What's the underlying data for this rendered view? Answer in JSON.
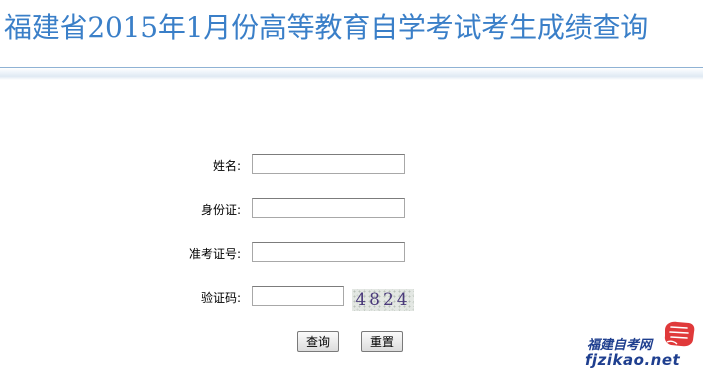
{
  "header": {
    "title": "福建省2015年1月份高等教育自学考试考生成绩查询"
  },
  "form": {
    "name_label": "姓名:",
    "id_label": "身份证:",
    "exam_no_label": "准考证号:",
    "captcha_label": "验证码:",
    "name_value": "",
    "id_value": "",
    "exam_no_value": "",
    "captcha_value": "",
    "captcha_text": "4824",
    "query_button": "查询",
    "reset_button": "重置"
  },
  "logo": {
    "cn_text": "福建自考网",
    "url_text": "fjzikao.net"
  },
  "colors": {
    "title": "#3a7fc8",
    "logo": "#1f3f8f",
    "logo_fist": "#e0393a"
  }
}
